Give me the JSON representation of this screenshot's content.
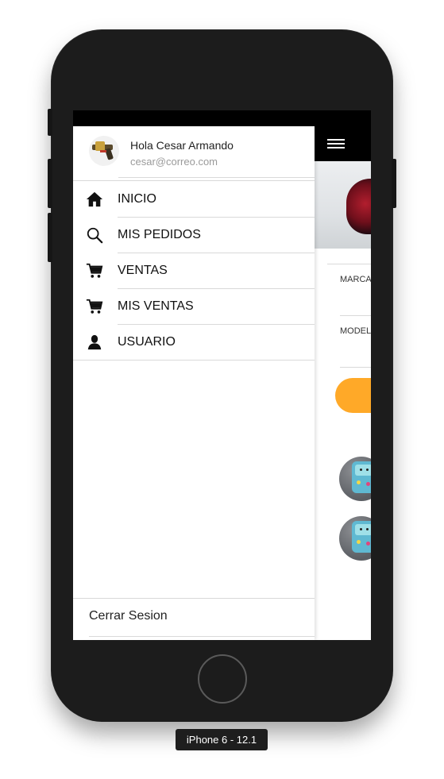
{
  "drawer": {
    "greeting": "Hola Cesar Armando",
    "email": "cesar@correo.com",
    "items": [
      {
        "label": "INICIO",
        "icon": "home-icon"
      },
      {
        "label": "MIS PEDIDOS",
        "icon": "search-icon"
      },
      {
        "label": "VENTAS",
        "icon": "cart-icon"
      },
      {
        "label": "MIS VENTAS",
        "icon": "cart-icon"
      },
      {
        "label": "USUARIO",
        "icon": "user-icon"
      }
    ],
    "logout_label": "Cerrar Sesion"
  },
  "app": {
    "field_labels": [
      "MARCA",
      "MODEL"
    ]
  },
  "device": {
    "label": "iPhone 6 - 12.1"
  },
  "colors": {
    "accent_orange": "#ffa928",
    "navbar": "#000000",
    "separator": "#d9d9d9"
  }
}
